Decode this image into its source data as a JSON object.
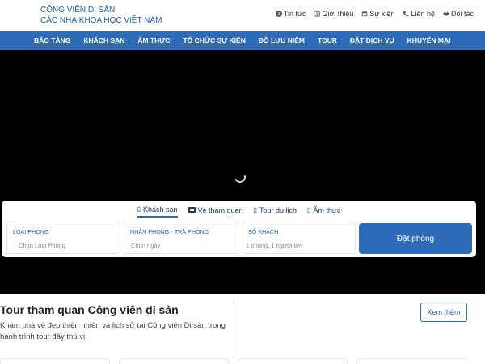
{
  "header": {
    "logo_line1": "CÔNG VIÊN DI SẢN",
    "logo_line2": "CÁC NHÀ KHOA HỌC VIỆT NAM",
    "links": [
      {
        "label": "Tin tức",
        "icon": "info-icon"
      },
      {
        "label": "Giới thiệu",
        "icon": "book-icon"
      },
      {
        "label": "Sự kiện",
        "icon": "calendar-icon"
      },
      {
        "label": "Liên hệ",
        "icon": "phone-icon"
      },
      {
        "label": "Đối tác",
        "icon": "handshake-icon"
      }
    ]
  },
  "nav": {
    "items": [
      "BẢO TÀNG",
      "KHÁCH SẠN",
      "ẨM THỰC",
      "TỔ CHỨC SỰ KIỆN",
      "ĐỒ LƯU NIỆM",
      "TOUR",
      "ĐẶT DỊCH VỤ",
      "KHUYẾN MẠI"
    ]
  },
  "search": {
    "tabs": [
      {
        "label": "Khách sạn",
        "icon": "placeholder-glyph-icon",
        "active": true
      },
      {
        "label": "Vé tham quan",
        "icon": "ticket-icon",
        "active": false
      },
      {
        "label": "Tour du lịch",
        "icon": "placeholder-glyph-icon",
        "active": false
      },
      {
        "label": "Ẩm thực",
        "icon": "placeholder-glyph-icon",
        "active": false
      }
    ],
    "fields": {
      "room_type": {
        "label": "LOẠI PHÒNG",
        "value": "Chọn Loại Phòng"
      },
      "dates": {
        "label": "NHẬN PHÒNG - TRẢ PHÒNG",
        "value": "Chọn ngày"
      },
      "guests": {
        "label": "SỐ KHÁCH",
        "value": "1 phòng, 1 người lớn"
      }
    },
    "book_button": "Đặt phòng"
  },
  "tour": {
    "title": "Tour tham quan Công viên di sản",
    "description": "Khám phá vẻ đẹp thiên nhiên và lịch sử tại Công viên Di sản trong hành trình tour đầy thú vị",
    "see_more": "Xem thêm"
  },
  "colors": {
    "primary": "#2e6bb8",
    "logo_text": "#1f5fae",
    "hero_bg": "#000000"
  }
}
